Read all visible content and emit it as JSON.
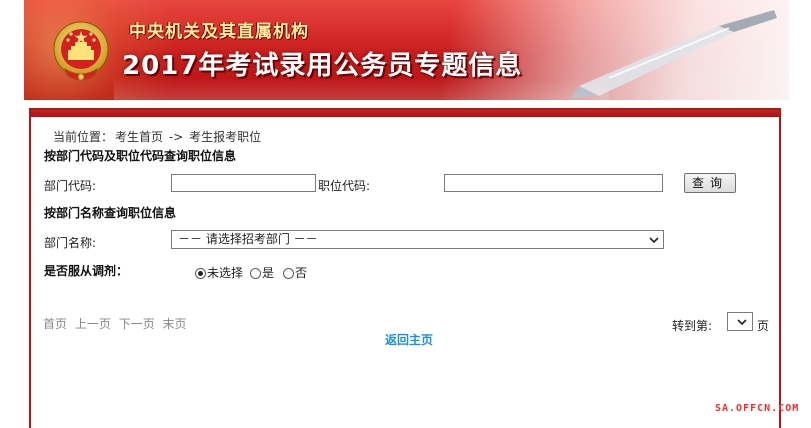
{
  "banner": {
    "subtitle": "中央机关及其直属机构",
    "title": "2017年考试录用公务员专题信息",
    "colors": {
      "red": "#c81d1d",
      "gold": "#fff3a0"
    }
  },
  "breadcrumb": {
    "prefix": "当前位置：",
    "home": "考生首页",
    "arrow": "->",
    "current": "考生报考职位"
  },
  "search_by_code": {
    "heading": "按部门代码及职位代码查询职位信息",
    "dept_code_label": "部门代码:",
    "dept_code_value": "",
    "position_code_label": "职位代码:",
    "position_code_value": "",
    "query_button": "查询"
  },
  "search_by_name": {
    "heading": "按部门名称查询职位信息",
    "dept_name_label": "部门名称:",
    "dept_select_value": "－－ 请选择招考部门 －－"
  },
  "adjustment": {
    "label": "是否服从调剂：",
    "options": [
      {
        "label": "未选择",
        "checked": true
      },
      {
        "label": "是",
        "checked": false
      },
      {
        "label": "否",
        "checked": false
      }
    ]
  },
  "pagination": {
    "first": "首页",
    "prev": "上一页",
    "next": "下一页",
    "last": "末页",
    "goto_label": "转到第:",
    "page_value": "",
    "page_unit": "页"
  },
  "back_link": "返回主页",
  "watermark": "SA.OFFCN.COM",
  "icons": {
    "emblem": "national-emblem-icon",
    "dropdown": "chevron-down-icon",
    "pen": "fountain-pen-icon"
  }
}
